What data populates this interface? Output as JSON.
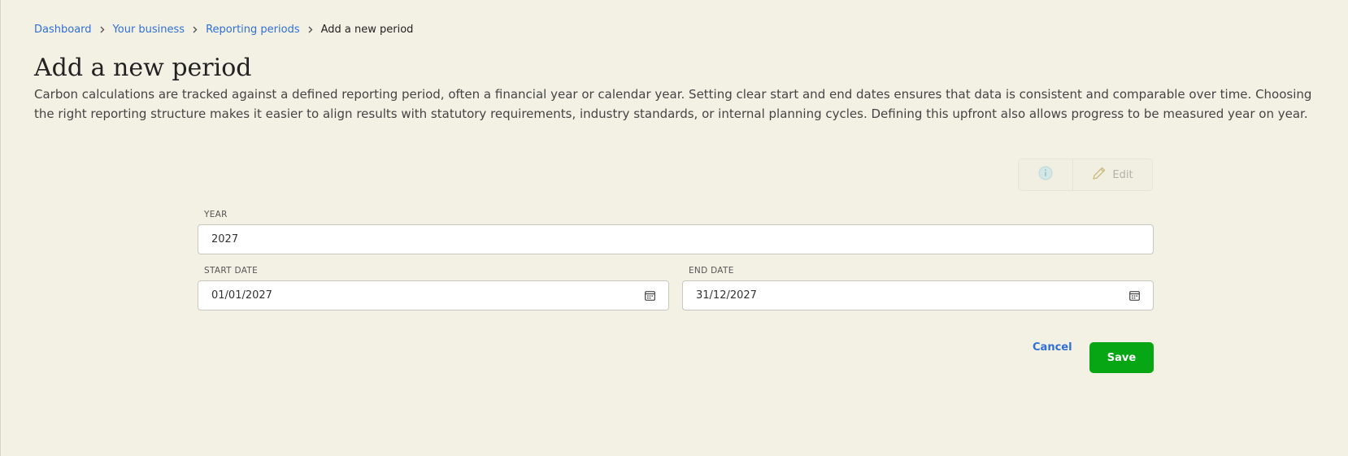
{
  "breadcrumb": {
    "items": [
      "Dashboard",
      "Your business",
      "Reporting periods"
    ],
    "current": "Add a new period"
  },
  "page": {
    "title": "Add a new period",
    "intro": "Carbon calculations are tracked against a defined reporting period, often a financial year or calendar year. Setting clear start and end dates ensures that data is consistent and comparable over time. Choosing the right reporting structure makes it easier to align results with statutory requirements, industry standards, or internal planning cycles. Defining this upfront also allows progress to be measured year on year."
  },
  "toolbar": {
    "info_icon": "info-icon",
    "edit_icon": "pencil-icon",
    "edit_label": "Edit"
  },
  "form": {
    "year_label": "YEAR",
    "year_value": "2027",
    "start_label": "START DATE",
    "start_value": "01/01/2027",
    "end_label": "END DATE",
    "end_value": "31/12/2027",
    "date_icon": "calendar-icon"
  },
  "actions": {
    "cancel_label": "Cancel",
    "save_label": "Save"
  },
  "colors": {
    "background": "#f3f1e4",
    "link": "#2f6fd6",
    "save": "#06a614"
  }
}
